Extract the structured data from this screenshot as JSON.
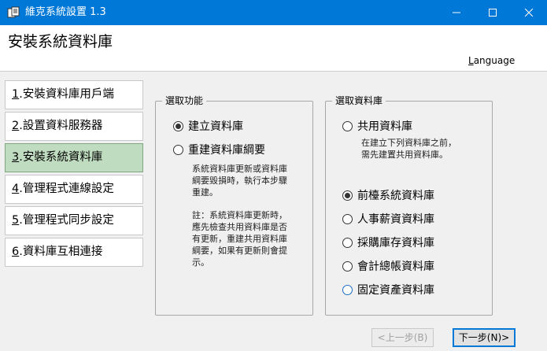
{
  "window": {
    "title": "維克系統設置 1.3",
    "icon": "app-icon",
    "controls": [
      "minimize-icon",
      "maximize-icon",
      "close-icon"
    ]
  },
  "header": {
    "heading": "安裝系統資料庫",
    "language_mnemonic": "L",
    "language_rest": "anguage"
  },
  "nav": {
    "items": [
      {
        "mnemonic": "1",
        "label": ".安裝資料庫用戶端"
      },
      {
        "mnemonic": "2",
        "label": ".設置資料服務器"
      },
      {
        "mnemonic": "3",
        "label": ".安裝系統資料庫",
        "active": true
      },
      {
        "mnemonic": "4",
        "label": ".管理程式連線設定"
      },
      {
        "mnemonic": "5",
        "label": ".管理程式同步設定"
      },
      {
        "mnemonic": "6",
        "label": ".資料庫互相連接"
      }
    ]
  },
  "function_group": {
    "title": "選取功能",
    "option_create": "建立資料庫",
    "option_rebuild": "重建資料庫綱要",
    "rebuild_desc_1": "系統資料庫更新或資料庫",
    "rebuild_desc_2": "綱要毀損時，執行本步驟",
    "rebuild_desc_3": "重建。",
    "note_1": "註：系統資料庫更新時，",
    "note_2": "應先檢查共用資料庫是否",
    "note_3": "有更新，重建共用資料庫",
    "note_4": "綱要，如果有更新則會提",
    "note_5": "示。",
    "selected": "建立資料庫"
  },
  "database_group": {
    "title": "選取資料庫",
    "option_shared": "共用資料庫",
    "shared_desc_1": "在建立下列資料庫之前，",
    "shared_desc_2": "需先建置共用資料庫。",
    "option_frontdesk": "前檯系統資料庫",
    "option_hr": "人事薪資資料庫",
    "option_purchase": "採購庫存資料庫",
    "option_accounting": "會計總帳資料庫",
    "option_assets": "固定資產資料庫",
    "selected": "前檯系統資料庫"
  },
  "footer": {
    "prev_label": "<上一步(B)",
    "next_label": "下一步(N)>"
  }
}
